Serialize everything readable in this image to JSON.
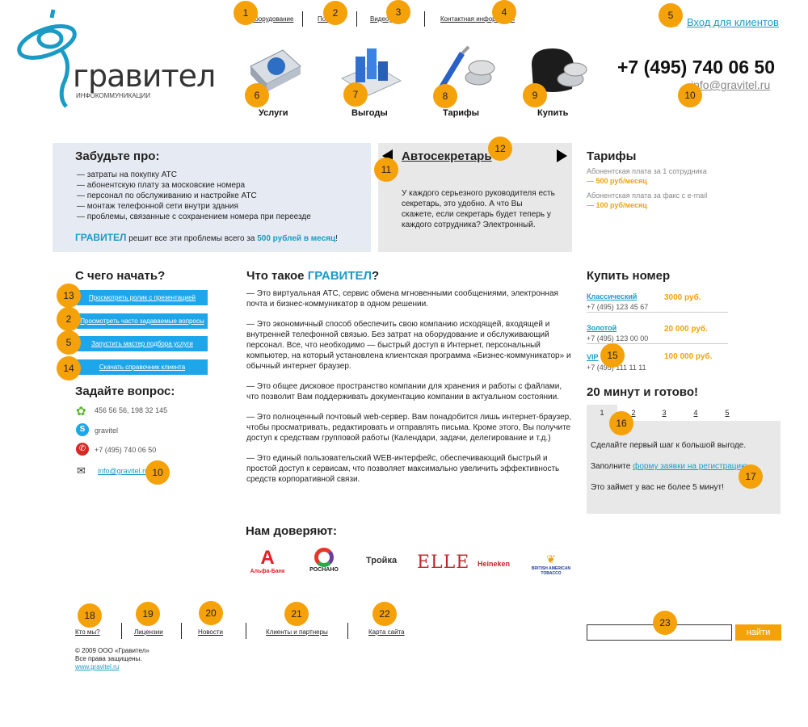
{
  "header": {
    "logo_text": "гравител",
    "logo_sub": "ИНФОКОММУНИКАЦИИ",
    "top_links": [
      "Оборудование",
      "Помощь",
      "Видеоуроки",
      "Контактная информация"
    ],
    "login_link": "Вход для клиентов",
    "phone": "+7 (495) 740 06 50",
    "email": "info@gravitel.ru",
    "nav": [
      {
        "label": "Услуги",
        "icon": "services-book-icon"
      },
      {
        "label": "Выгоды",
        "icon": "benefits-chart-icon"
      },
      {
        "label": "Тарифы",
        "icon": "tariffs-tools-icon"
      },
      {
        "label": "Купить",
        "icon": "buy-wallet-icon"
      }
    ]
  },
  "forget": {
    "title": "Забудьте про:",
    "items": [
      "— затраты на покупку АТС",
      "— абонентскую плату за московские номера",
      "— персонал по обслуживанию и настройке АТС",
      "— монтаж телефонной сети внутри здания",
      "— проблемы, связанные с сохранением номера при переезде"
    ],
    "brand": "ГРАВИТЕЛ",
    "summary_mid": " решит все эти проблемы всего за ",
    "summary_price": "500 рублей в месяц",
    "summary_end": "!"
  },
  "slider": {
    "title": "Автосекретарь",
    "text": "У каждого серьезного руководителя есть секретарь, это удобно. А что Вы скажете, если секретарь будет теперь у каждого сотрудника? Электронный."
  },
  "tariffs": {
    "title": "Тарифы",
    "line1": "Абонентская плата за 1 сотрудника",
    "price1": "— 500 руб/месяц",
    "line2": "Абонентская плата за факс с e-mail",
    "price2": "— 100 руб/месяц"
  },
  "start": {
    "title": "С чего начать?",
    "buttons": [
      "Просмотреть ролик с презентацией",
      "Просмотреть часто задаваемые вопросы",
      "Запустить мастер подбора услуги",
      "Скачать справочник клиента"
    ]
  },
  "ask": {
    "title": "Задайте вопрос:",
    "icq": "456 56 56, 198 32 145",
    "skype": "gravitel",
    "phone": "+7 (495) 740 06 50",
    "email": "info@gravitel.ru"
  },
  "what": {
    "title_pre": "Что такое ",
    "title_brand": "ГРАВИТЕЛ",
    "title_end": "?",
    "p1": "— Это виртуальная АТС, сервис обмена мгновенными сообщениями, электронная почта и бизнес-коммуникатор в одном решении.",
    "p2": "— Это экономичный способ обеспечить свою компанию исходящей, входящей и внутренней телефонной связью. Без затрат на оборудование и обслуживающий персонал. Все, что необходимо — быстрый доступ в Интернет, персональный компьютер, на который установлена клиентская программа «Бизнес-коммуникатор» и обычный интернет браузер.",
    "p3": "— Это общее дисковое пространство компании для хранения и работы с файлами, что позволит Вам поддерживать документацию компании в актуальном состоянии.",
    "p4": "— Это полноценный почтовый web-сервер. Вам понадобится лишь интернет-браузер, чтобы просматривать, редактировать и отправлять письма. Кроме этого, Вы получите доступ к средствам групповой работы (Календари, задачи, делегирование и т.д.)",
    "p5": "— Это единый пользовательский WEB-интерфейс, обеспечивающий быстрый и простой доступ к сервисам, что позволяет максимально увеличить эффективность средств корпоративной связи."
  },
  "trust": {
    "title": "Нам доверяют:",
    "logos": [
      "Альфа-Банк",
      "РОСНАНО",
      "Тройка",
      "ELLE",
      "Heineken",
      "BRITISH AMERICAN TOBACCO"
    ]
  },
  "buy": {
    "title": "Купить номер",
    "rows": [
      {
        "name": "Классический",
        "phone": "+7 (495) 123 45 67",
        "price": "3000 руб."
      },
      {
        "name": "Золотой",
        "phone": "+7 (495) 123 00 00",
        "price": "20 000 руб."
      },
      {
        "name": "VIP",
        "phone": "+7 (495) 111 11 11",
        "price": "100 000 руб."
      }
    ]
  },
  "twenty": {
    "title": "20 минут и готово!",
    "tabs": [
      "1",
      "2",
      "3",
      "4",
      "5"
    ],
    "line1": "Сделайте первый  шаг к большой выгоде.",
    "line2_pre": "Заполните ",
    "line2_link": "форму заявки на регистрацию",
    "line3": "Это займет у вас не более 5 минут!"
  },
  "footer": {
    "links": [
      "Кто мы?",
      "Лицензии",
      "Новости",
      "Клиенты и партнеры",
      "Карта сайта"
    ],
    "search_button": "найти",
    "copyright": "© 2009 ООО «Гравител»",
    "rights": "Все права защищены.",
    "site": "www.gravitel.ru"
  },
  "markers": [
    "1",
    "2",
    "3",
    "4",
    "5",
    "6",
    "7",
    "8",
    "9",
    "10",
    "11",
    "12",
    "13",
    "2",
    "5",
    "14",
    "10",
    "15",
    "16",
    "17",
    "18",
    "19",
    "20",
    "21",
    "22",
    "23"
  ],
  "colors": {
    "accent": "#1a9bc6",
    "orange": "#f5a10a",
    "button": "#1ea6ea",
    "panel": "#e6ebf3",
    "grey_panel": "#e8e8e8"
  }
}
